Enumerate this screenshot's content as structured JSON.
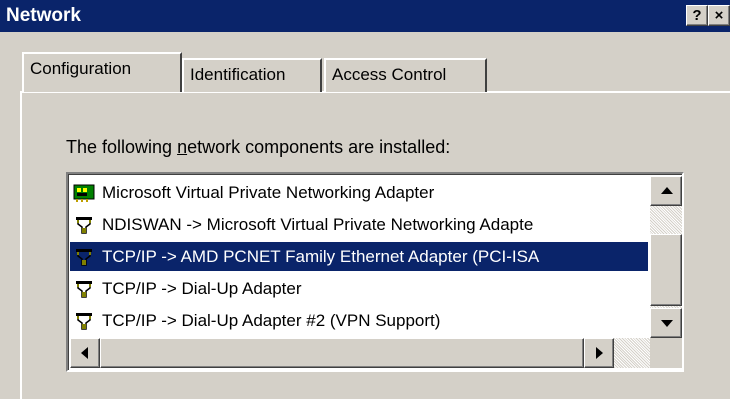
{
  "window": {
    "title": "Network",
    "help_button": "?",
    "close_button": "×",
    "titlebar_color": "#0a246a",
    "face_color": "#d4d0c8"
  },
  "tabs": [
    {
      "label": "Configuration",
      "active": true
    },
    {
      "label": "Identification",
      "active": false
    },
    {
      "label": "Access Control",
      "active": false
    }
  ],
  "components": {
    "label_before": "The following ",
    "label_accel": "n",
    "label_after": "etwork components are installed:",
    "items": [
      {
        "text": "Microsoft Virtual Private Networking Adapter",
        "icon": "network-adapter-icon",
        "selected": false
      },
      {
        "text": "NDISWAN -> Microsoft Virtual Private Networking Adapte",
        "icon": "protocol-icon",
        "selected": false
      },
      {
        "text": "TCP/IP -> AMD PCNET Family Ethernet Adapter (PCI-ISA",
        "icon": "protocol-icon",
        "selected": true
      },
      {
        "text": "TCP/IP -> Dial-Up Adapter",
        "icon": "protocol-icon",
        "selected": false
      },
      {
        "text": "TCP/IP -> Dial-Up Adapter #2 (VPN Support)",
        "icon": "protocol-icon",
        "selected": false
      }
    ]
  }
}
